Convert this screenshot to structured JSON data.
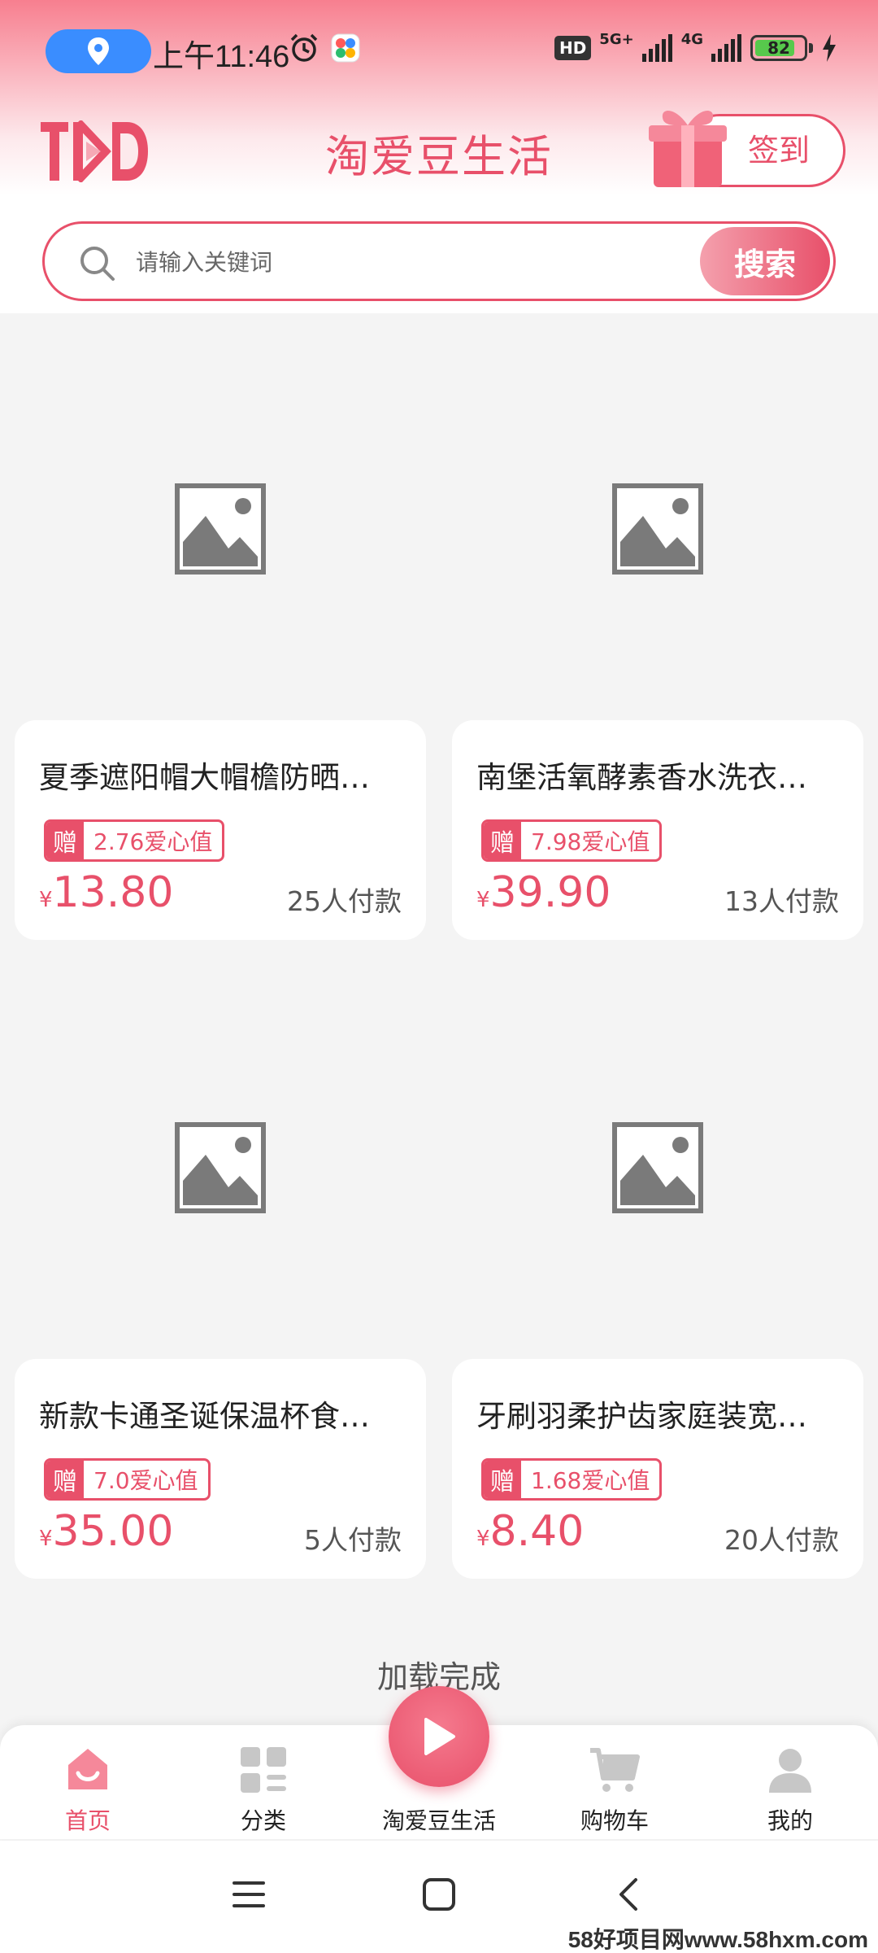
{
  "status_bar": {
    "time": "上午11:46",
    "hd": "HD",
    "net_5g": "5G+",
    "net_4g": "4G",
    "battery": "82",
    "battery_level": 0.82
  },
  "header": {
    "title": "淘爱豆生活",
    "signin_label": "签到"
  },
  "search": {
    "placeholder": "请输入关键词",
    "button_label": "搜索"
  },
  "products": [
    {
      "title": "夏季遮阳帽大帽檐防晒…",
      "gift_tag": "赠",
      "gift_value": "2.76爱心值",
      "currency": "¥",
      "price": "13.80",
      "sold": "25人付款"
    },
    {
      "title": "南堡活氧酵素香水洗衣…",
      "gift_tag": "赠",
      "gift_value": "7.98爱心值",
      "currency": "¥",
      "price": "39.90",
      "sold": "13人付款"
    },
    {
      "title": "新款卡通圣诞保温杯食…",
      "gift_tag": "赠",
      "gift_value": "7.0爱心值",
      "currency": "¥",
      "price": "35.00",
      "sold": "5人付款"
    },
    {
      "title": "牙刷羽柔护齿家庭装宽…",
      "gift_tag": "赠",
      "gift_value": "1.68爱心值",
      "currency": "¥",
      "price": "8.40",
      "sold": "20人付款"
    }
  ],
  "load_status": "加载完成",
  "tabbar": {
    "home": "首页",
    "category": "分类",
    "center": "淘爱豆生活",
    "cart": "购物车",
    "mine": "我的"
  },
  "watermark": "58好项目网www.58hxm.com",
  "colors": {
    "accent": "#e8506a",
    "location_pill": "#3a8dff",
    "battery": "#57c94c"
  }
}
